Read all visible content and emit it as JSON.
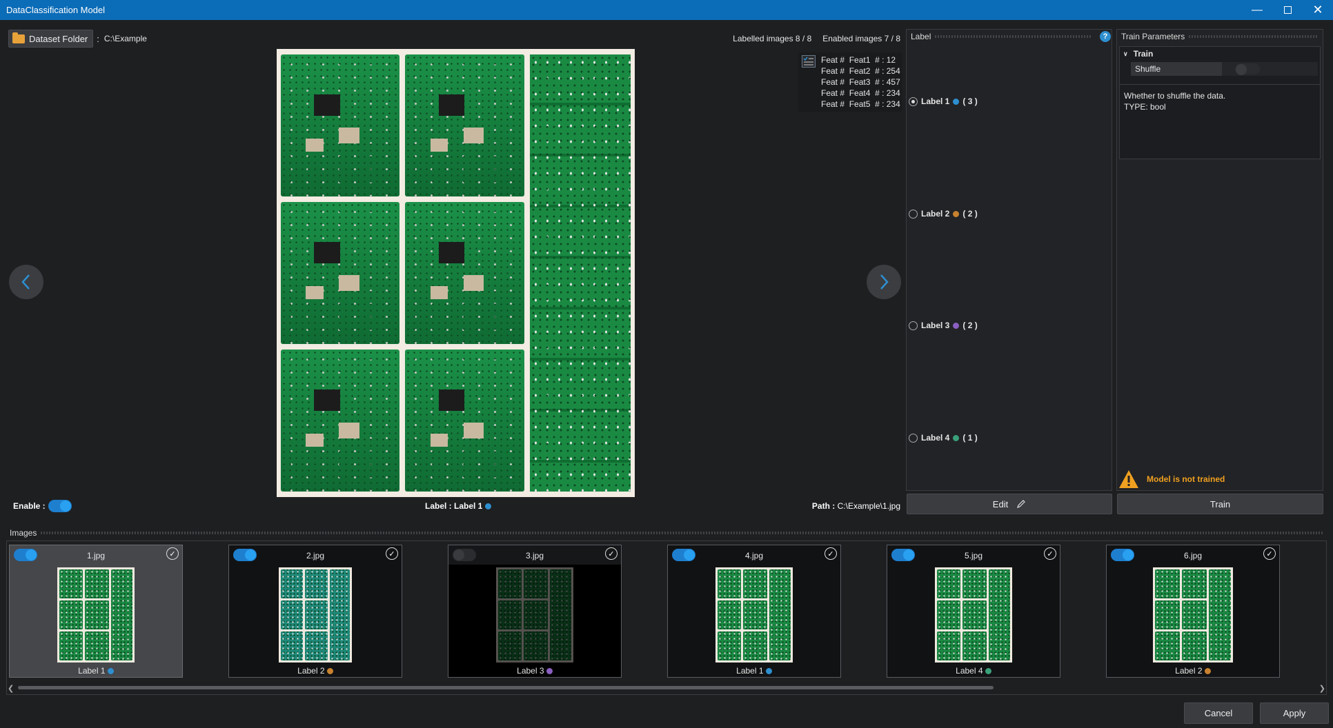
{
  "window": {
    "title": "DataClassification Model"
  },
  "toolbar": {
    "dataset_button": "Dataset Folder",
    "path_sep": ":",
    "path": "C:\\Example",
    "labelled": "Labelled images 8 / 8",
    "enabled": "Enabled images 7 / 8"
  },
  "features": [
    {
      "a": "Feat #",
      "b": "Feat1",
      "c": "# : 12"
    },
    {
      "a": "Feat #",
      "b": "Feat2",
      "c": "# : 254"
    },
    {
      "a": "Feat #",
      "b": "Feat3",
      "c": "# : 457"
    },
    {
      "a": "Feat #",
      "b": "Feat4",
      "c": "# : 234"
    },
    {
      "a": "Feat #",
      "b": "Feat5",
      "c": "# : 234"
    }
  ],
  "status": {
    "enable_label": "Enable :",
    "enable_on": true,
    "label_text": "Label : Label 1",
    "label_color": "#2e8fd0",
    "path_label": "Path :",
    "path_value": "C:\\Example\\1.jpg"
  },
  "label_panel": {
    "title": "Label",
    "labels": [
      {
        "name": "Label 1",
        "count": "( 3 )",
        "color": "#2e8fd0",
        "selected": true
      },
      {
        "name": "Label 2",
        "count": "( 2 )",
        "color": "#c8822f",
        "selected": false
      },
      {
        "name": "Label 3",
        "count": "( 2 )",
        "color": "#8a5fc0",
        "selected": false
      },
      {
        "name": "Label 4",
        "count": "( 1 )",
        "color": "#3aa07a",
        "selected": false
      }
    ],
    "edit_button": "Edit"
  },
  "train_panel": {
    "title": "Train Parameters",
    "group": "Train",
    "param_name": "Shuffle",
    "param_value": false,
    "description_line1": "Whether to shuffle the data.",
    "description_line2": "TYPE: bool",
    "warning": "Model is not trained",
    "warning_color": "#f0a020",
    "train_button": "Train"
  },
  "images": {
    "title": "Images",
    "items": [
      {
        "name": "1.jpg",
        "enabled": true,
        "label": "Label 1",
        "color": "#2e8fd0"
      },
      {
        "name": "2.jpg",
        "enabled": true,
        "label": "Label 2",
        "color": "#c8822f"
      },
      {
        "name": "3.jpg",
        "enabled": false,
        "label": "Label 3",
        "color": "#8a5fc0"
      },
      {
        "name": "4.jpg",
        "enabled": true,
        "label": "Label 1",
        "color": "#2e8fd0"
      },
      {
        "name": "5.jpg",
        "enabled": true,
        "label": "Label 4",
        "color": "#3aa07a"
      },
      {
        "name": "6.jpg",
        "enabled": true,
        "label": "Label 2",
        "color": "#c8822f"
      }
    ]
  },
  "footer": {
    "cancel": "Cancel",
    "apply": "Apply"
  }
}
